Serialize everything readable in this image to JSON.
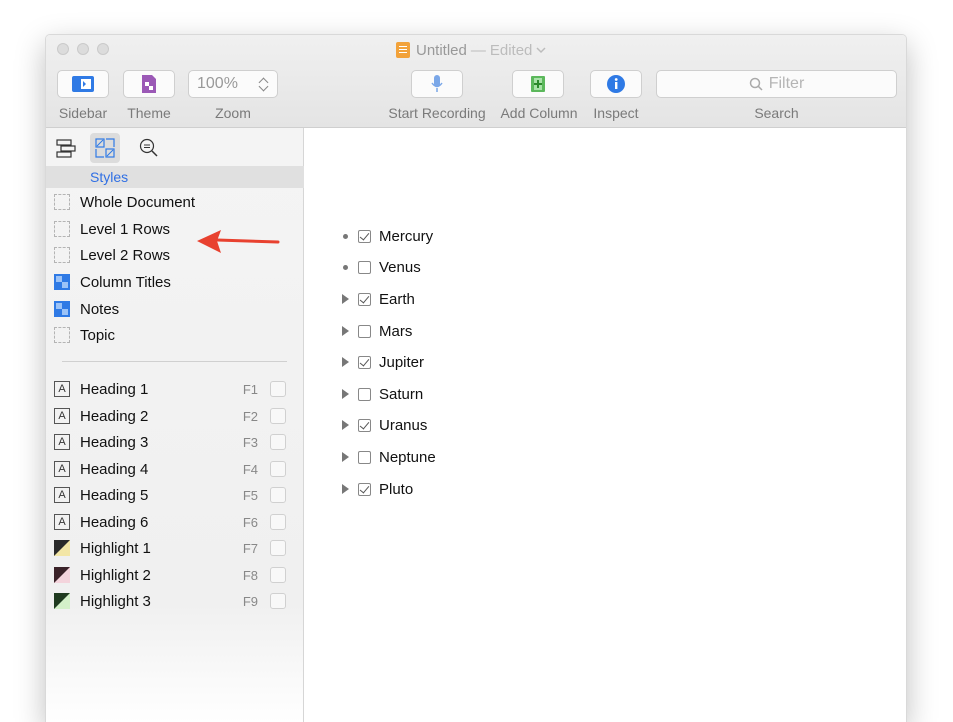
{
  "window": {
    "title": "Untitled",
    "title_sep": "—",
    "title_state": "Edited"
  },
  "toolbar": {
    "sidebar_label": "Sidebar",
    "theme_label": "Theme",
    "zoom_value": "100%",
    "zoom_label": "Zoom",
    "start_recording_label": "Start Recording",
    "add_column_label": "Add Column",
    "inspect_label": "Inspect",
    "search_placeholder": "Filter",
    "search_label": "Search",
    "accent_color": "#2f7ae5"
  },
  "sidebar": {
    "tabs": [
      "outline-tab-icon",
      "styles-tab-icon",
      "search-tab-icon"
    ],
    "section_title": "Styles",
    "styles": [
      {
        "label": "Whole Document",
        "icon": "dashed-box-icon"
      },
      {
        "label": "Level 1 Rows",
        "icon": "dashed-box-icon"
      },
      {
        "label": "Level 2 Rows",
        "icon": "dashed-box-icon"
      },
      {
        "label": "Column Titles",
        "icon": "blue-style-icon"
      },
      {
        "label": "Notes",
        "icon": "blue-style-icon"
      },
      {
        "label": "Topic",
        "icon": "dashed-box-icon"
      }
    ],
    "named_styles": [
      {
        "label": "Heading 1",
        "key": "F1",
        "icon": "A"
      },
      {
        "label": "Heading 2",
        "key": "F2",
        "icon": "A"
      },
      {
        "label": "Heading 3",
        "key": "F3",
        "icon": "A"
      },
      {
        "label": "Heading 4",
        "key": "F4",
        "icon": "A"
      },
      {
        "label": "Heading 5",
        "key": "F5",
        "icon": "A"
      },
      {
        "label": "Heading 6",
        "key": "F6",
        "icon": "A"
      },
      {
        "label": "Highlight 1",
        "key": "F7",
        "color": "#f3e6a6"
      },
      {
        "label": "Highlight 2",
        "key": "F8",
        "color": "#f4d4dc"
      },
      {
        "label": "Highlight 3",
        "key": "F9",
        "color": "#d4f0c9"
      }
    ]
  },
  "outline": {
    "rows": [
      {
        "label": "Mercury",
        "checked": true,
        "handle": "dot"
      },
      {
        "label": "Venus",
        "checked": false,
        "handle": "dot"
      },
      {
        "label": "Earth",
        "checked": true,
        "handle": "triangle"
      },
      {
        "label": "Mars",
        "checked": false,
        "handle": "triangle"
      },
      {
        "label": "Jupiter",
        "checked": true,
        "handle": "triangle"
      },
      {
        "label": "Saturn",
        "checked": false,
        "handle": "triangle"
      },
      {
        "label": "Uranus",
        "checked": true,
        "handle": "triangle"
      },
      {
        "label": "Neptune",
        "checked": false,
        "handle": "triangle"
      },
      {
        "label": "Pluto",
        "checked": true,
        "handle": "triangle"
      }
    ]
  },
  "annotation": {
    "arrow_color": "#e8412f"
  }
}
